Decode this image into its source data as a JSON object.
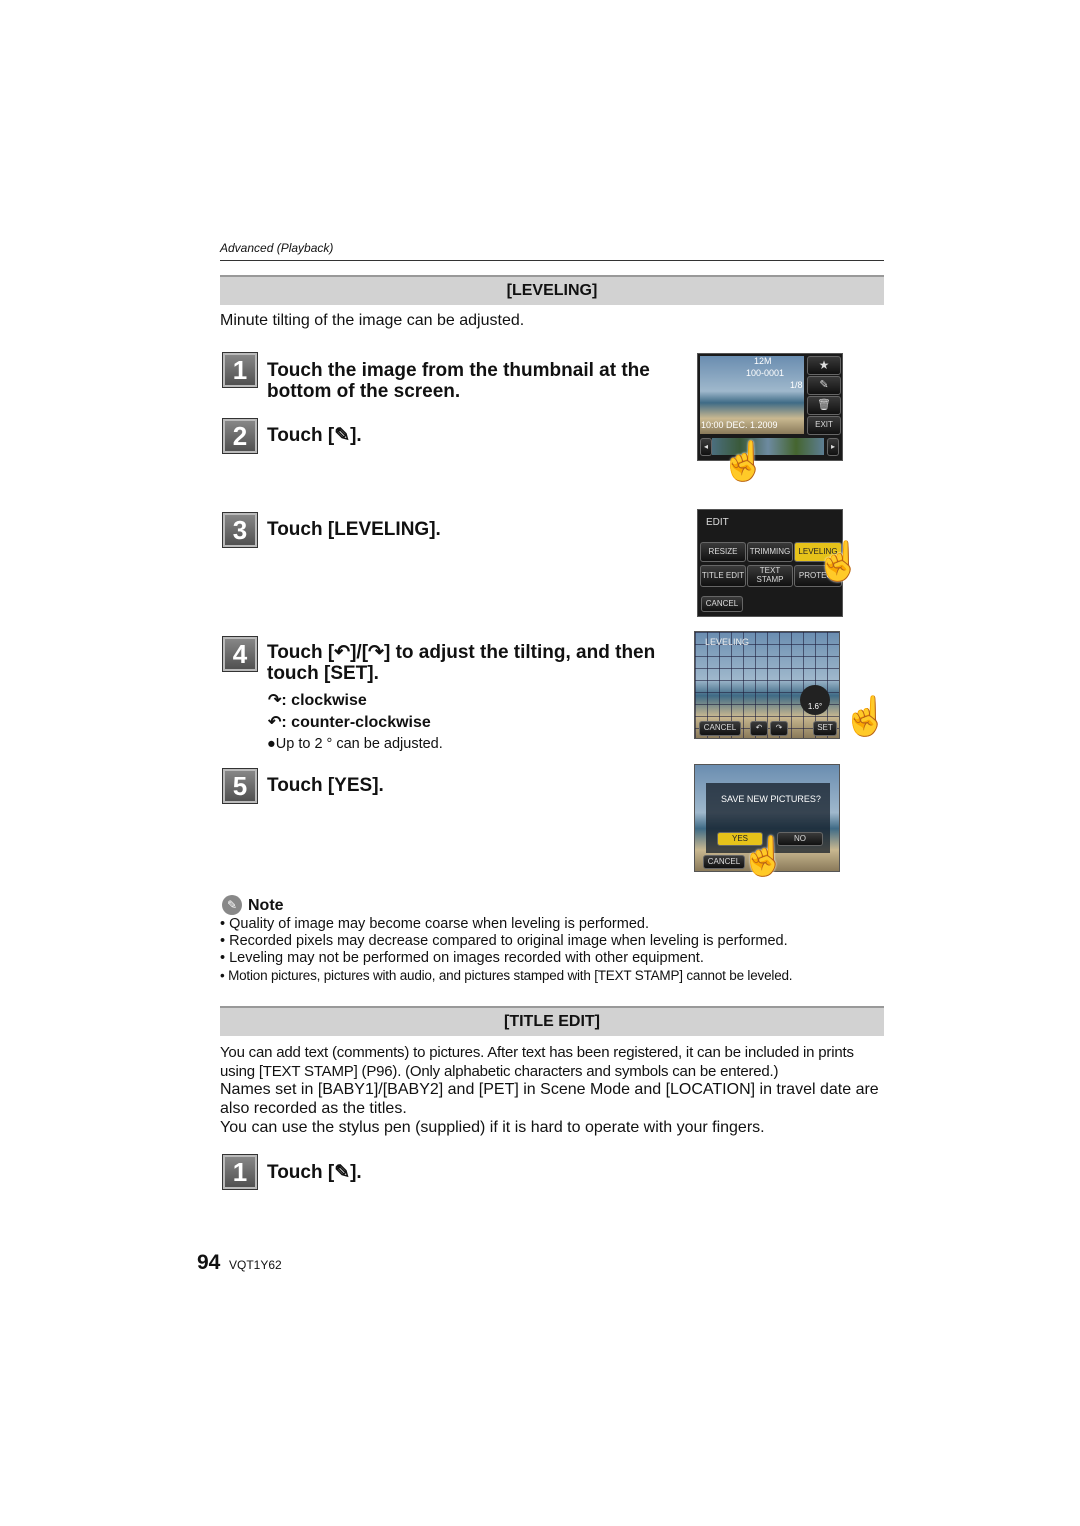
{
  "header": {
    "section": "Advanced (Playback)"
  },
  "leveling": {
    "title": "[LEVELING]",
    "intro": "Minute tilting of the image can be adjusted.",
    "steps": [
      {
        "num": "1",
        "text": "Touch the image from the thumbnail at the bottom of the screen."
      },
      {
        "num": "2",
        "text_before": "Touch [",
        "text_after": "]."
      },
      {
        "num": "3",
        "text": "Touch [LEVELING]."
      },
      {
        "num": "4",
        "text_a": "Touch [",
        "text_b": "]/[",
        "text_c": "] to adjust the tilting, and then touch [SET].",
        "cw": ": clockwise",
        "ccw": ": counter-clockwise",
        "bullet": "●Up to 2 ° can be adjusted."
      },
      {
        "num": "5",
        "text": "Touch [YES]."
      }
    ],
    "screen1": {
      "quality": "12M",
      "folder": "100-0001",
      "count": "1/8",
      "datetime": "10:00  DEC.  1.2009",
      "exit": "EXIT"
    },
    "screen2": {
      "title": "EDIT",
      "buttons": [
        "RESIZE",
        "TRIMMING",
        "LEVELING",
        "TITLE EDIT",
        "TEXT STAMP",
        "PROTECT"
      ],
      "cancel": "CANCEL"
    },
    "screen3": {
      "title": "LEVELING",
      "angle": "1.6°",
      "cancel": "CANCEL",
      "set": "SET"
    },
    "screen4": {
      "question": "SAVE NEW PICTURES?",
      "yes": "YES",
      "no": "NO",
      "cancel": "CANCEL"
    }
  },
  "note": {
    "title": "Note",
    "items": [
      "Quality of image may become coarse when leveling is performed.",
      "Recorded pixels may decrease compared to original image when leveling is performed.",
      "Leveling may not be performed on images recorded with other equipment.",
      "Motion pictures, pictures with audio, and pictures stamped with [TEXT STAMP] cannot be leveled."
    ]
  },
  "title_edit": {
    "title": "[TITLE EDIT]",
    "para1": "You can add text (comments) to pictures. After text has been registered, it can be included in prints using [TEXT STAMP] (P96). (Only alphabetic characters and symbols can be entered.)",
    "para2": "Names set in [BABY1]/[BABY2] and [PET] in Scene Mode and [LOCATION] in travel date are also recorded as the titles.",
    "para3": "You can use the stylus pen (supplied) if it is hard to operate with your fingers.",
    "step1": {
      "num": "1",
      "text_before": "Touch [",
      "text_after": "]."
    }
  },
  "footer": {
    "page": "94",
    "code": "VQT1Y62"
  }
}
